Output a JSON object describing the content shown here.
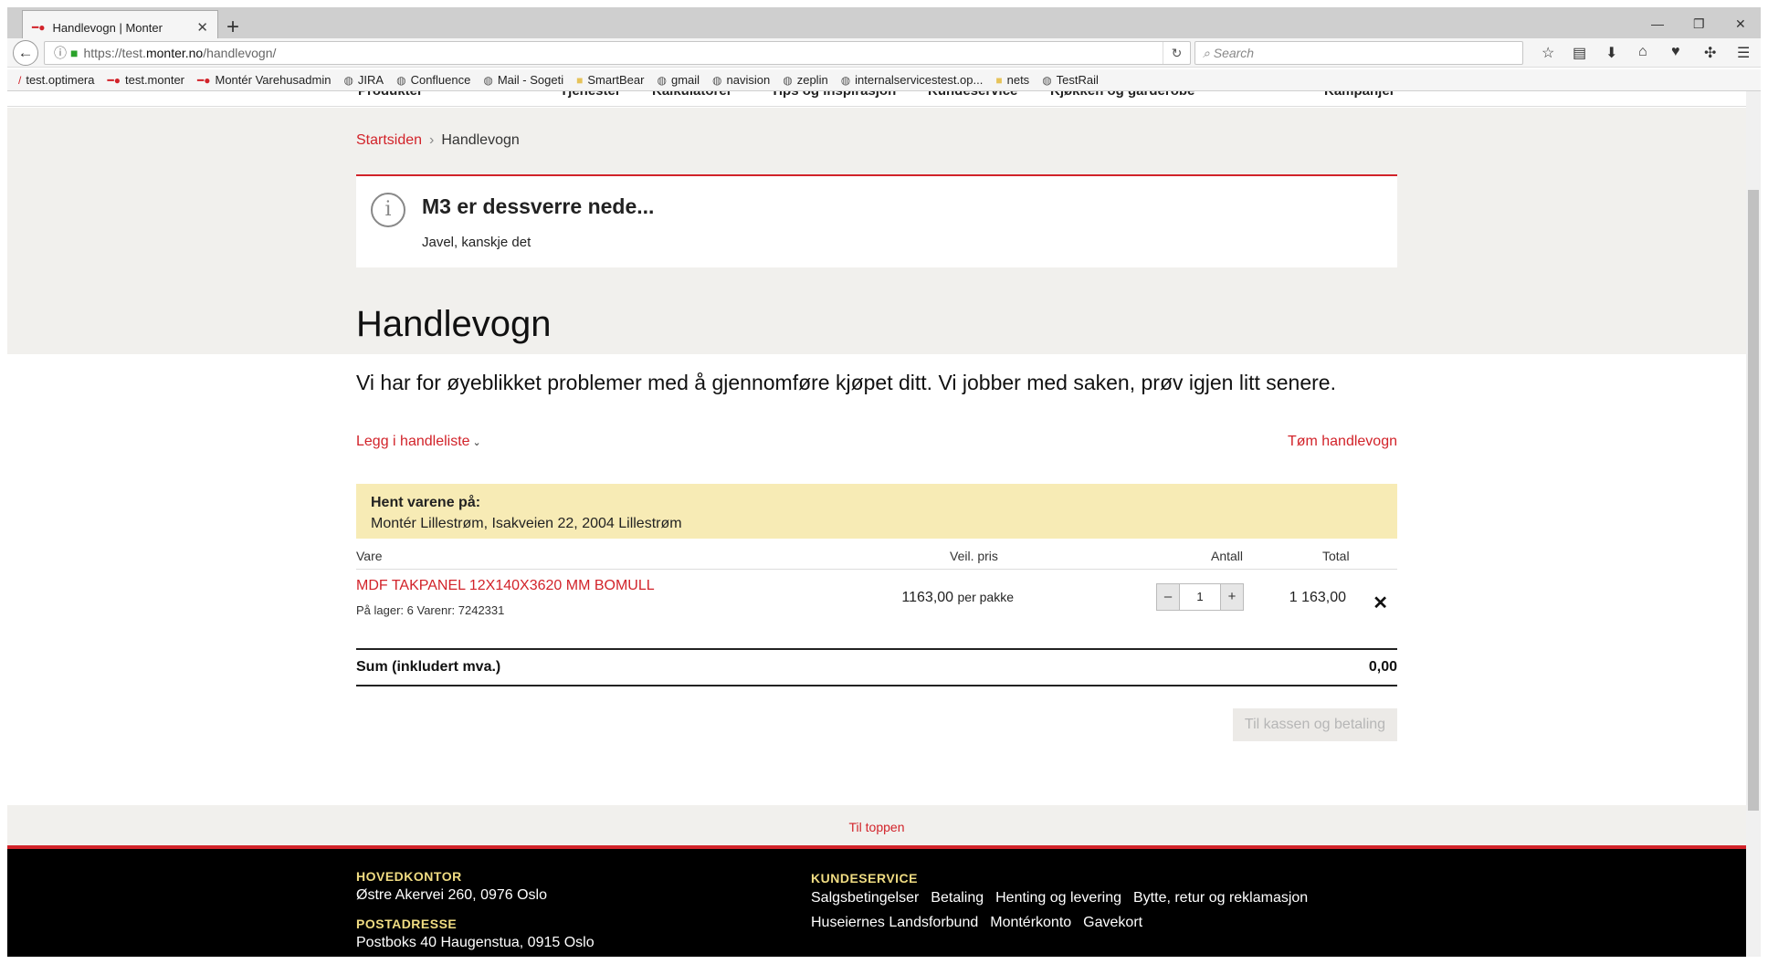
{
  "browser": {
    "tab_title": "Handlevogn | Monter",
    "url_prefix": "https://test.",
    "url_domain": "monter.no",
    "url_path": "/handlevogn/",
    "search_placeholder": "Search",
    "bookmarks": [
      {
        "label": "test.optimera",
        "icon": "slash-icon"
      },
      {
        "label": "test.monter",
        "icon": "monter-icon"
      },
      {
        "label": "Montér Varehusadmin",
        "icon": "monter-icon"
      },
      {
        "label": "JIRA",
        "icon": "globe-icon"
      },
      {
        "label": "Confluence",
        "icon": "globe-icon"
      },
      {
        "label": "Mail - Sogeti",
        "icon": "globe-icon"
      },
      {
        "label": "SmartBear",
        "icon": "folder-icon"
      },
      {
        "label": "gmail",
        "icon": "globe-icon"
      },
      {
        "label": "navision",
        "icon": "globe-icon"
      },
      {
        "label": "zeplin",
        "icon": "globe-icon"
      },
      {
        "label": "internalservicestest.op...",
        "icon": "globe-icon"
      },
      {
        "label": "nets",
        "icon": "folder-icon"
      },
      {
        "label": "TestRail",
        "icon": "globe-icon"
      }
    ]
  },
  "topnav": [
    "Produkter",
    "Tjenester",
    "Kalkulatorer",
    "Tips og inspirasjon",
    "Kundeservice",
    "Kjøkken og garderobe",
    "Kampanjer"
  ],
  "breadcrumb": {
    "home": "Startsiden",
    "current": "Handlevogn"
  },
  "alert": {
    "title": "M3 er dessverre nede...",
    "message": "Javel, kanskje det"
  },
  "page_title": "Handlevogn",
  "problem_message": "Vi har for øyeblikket problemer med å gjennomføre kjøpet ditt. Vi jobber med saken, prøv igjen litt senere.",
  "actions": {
    "add_to_list": "Legg i handleliste",
    "empty_cart": "Tøm handlevogn"
  },
  "pickup": {
    "label": "Hent varene på:",
    "address": "Montér Lillestrøm, Isakveien 22, 2004 Lillestrøm"
  },
  "table": {
    "headers": {
      "item": "Vare",
      "price": "Veil. pris",
      "qty": "Antall",
      "total": "Total"
    },
    "rows": [
      {
        "name": "MDF TAKPANEL 12X140X3620 MM BOMULL",
        "meta": "På lager: 6  Varenr: 7242331",
        "price": "1163,00",
        "unit": "per pakke",
        "qty": "1",
        "total": "1 163,00"
      }
    ]
  },
  "sum": {
    "label": "Sum (inkludert mva.)",
    "value": "0,00"
  },
  "checkout_label": "Til kassen og betaling",
  "to_top": "Til toppen",
  "footer": {
    "hq_title": "HOVEDKONTOR",
    "hq_address": "Østre Akervei 260, 0976 Oslo",
    "postal_title": "POSTADRESSE",
    "postal_address": "Postboks 40 Haugenstua, 0915 Oslo",
    "cs_title": "KUNDESERVICE",
    "cs_links_row1": [
      "Salgsbetingelser",
      "Betaling",
      "Henting og levering",
      "Bytte, retur og reklamasjon"
    ],
    "cs_links_row2": [
      "Huseiernes Landsforbund",
      "Montérkonto",
      "Gavekort"
    ]
  },
  "colors": {
    "brand_red": "#d2232a",
    "pickup_bg": "#f7ebb5",
    "footer_heading": "#f0dc82"
  }
}
